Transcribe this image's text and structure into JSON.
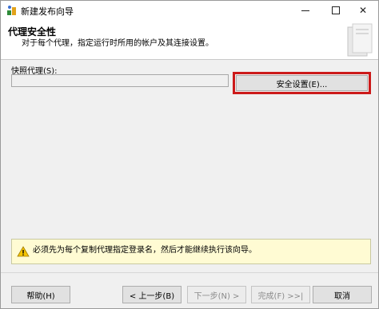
{
  "window": {
    "title": "新建发布向导"
  },
  "header": {
    "title": "代理安全性",
    "subtitle": "对于每个代理，指定运行时所用的帐户及其连接设置。"
  },
  "snapshot_agent": {
    "label": "快照代理(S):",
    "value": "",
    "security_button": "安全设置(E)..."
  },
  "warning": {
    "message": "必须先为每个复制代理指定登录名，然后才能继续执行该向导。"
  },
  "footer": {
    "help": "帮助(H)",
    "back": "< 上一步(B)",
    "next": "下一步(N) >",
    "finish": "完成(F) >>|",
    "cancel": "取消"
  },
  "colors": {
    "highlight": "#cc1a1a",
    "warning_bg": "#fffbd3"
  },
  "icons": {
    "app": "wizard-app-icon",
    "header": "publication-graphic-icon",
    "warning": "warning-icon"
  }
}
